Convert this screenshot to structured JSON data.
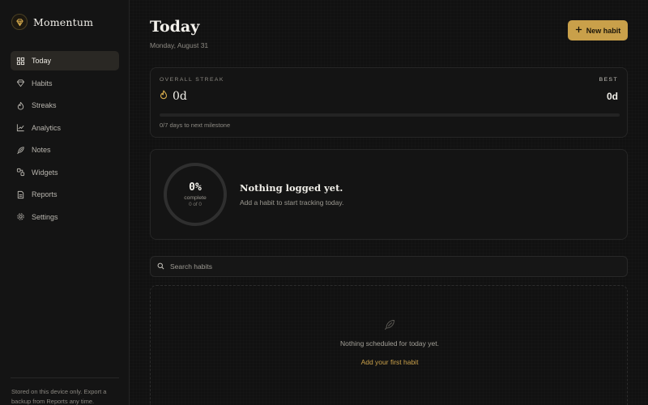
{
  "app": {
    "name": "Momentum",
    "accent": "#c9a04a"
  },
  "sidebar": {
    "items": [
      {
        "label": "Today",
        "icon": "grid-icon",
        "active": true
      },
      {
        "label": "Habits",
        "icon": "gem-icon"
      },
      {
        "label": "Streaks",
        "icon": "flame-icon"
      },
      {
        "label": "Analytics",
        "icon": "chart-line-icon"
      },
      {
        "label": "Notes",
        "icon": "feather-icon"
      },
      {
        "label": "Widgets",
        "icon": "widgets-icon"
      },
      {
        "label": "Reports",
        "icon": "document-icon"
      },
      {
        "label": "Settings",
        "icon": "gear-icon"
      }
    ],
    "footer_note": "Stored on this device only. Export a backup from Reports any time."
  },
  "header": {
    "title": "Today",
    "date": "Monday, August 31",
    "new_button_label": "New habit"
  },
  "streak": {
    "label": "OVERALL STREAK",
    "value": "0d",
    "best_label": "BEST",
    "best_value": "0d",
    "progress_fraction": 0,
    "milestone_text": "0/7 days to next milestone"
  },
  "today_progress": {
    "percent_text": "0%",
    "percent_value": 0,
    "sub_label": "complete",
    "count_text": "0 of 0",
    "title": "Nothing logged yet.",
    "subtitle": "Add a habit to start tracking today."
  },
  "search": {
    "placeholder": "Search habits",
    "value": ""
  },
  "habit_list": {
    "empty_message": "Nothing scheduled for today yet.",
    "add_first_label": "Add your first habit"
  }
}
